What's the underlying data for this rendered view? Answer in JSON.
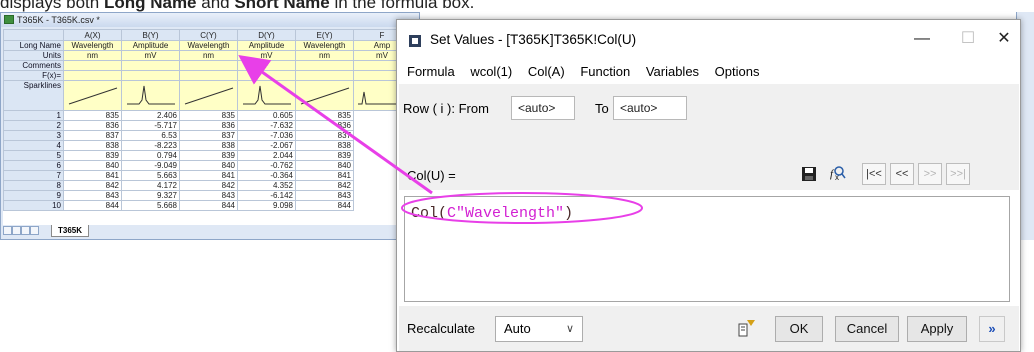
{
  "caption": {
    "prefix": "displays both ",
    "long_name": "Long Name",
    "middle": " and ",
    "short_name": "Short Name",
    "suffix": " in the formula box."
  },
  "worksheet": {
    "title": "T365K - T365K.csv *",
    "columns": [
      "A(X)",
      "B(Y)",
      "C(Y)",
      "D(Y)",
      "E(Y)",
      "F"
    ],
    "row_labels": {
      "long_name": "Long Name",
      "units": "Units",
      "comments": "Comments",
      "fx": "F(x)=",
      "sparklines": "Sparklines"
    },
    "long_names": [
      "Wavelength",
      "Amplitude",
      "Wavelength",
      "Amplitude",
      "Wavelength",
      "Amp"
    ],
    "units": [
      "nm",
      "mV",
      "nm",
      "mV",
      "nm",
      "mV"
    ],
    "rows": [
      [
        "1",
        "835",
        "2.406",
        "835",
        "0.605",
        "835"
      ],
      [
        "2",
        "836",
        "-5.717",
        "836",
        "-7.632",
        "836"
      ],
      [
        "3",
        "837",
        "6.53",
        "837",
        "-7.036",
        "837"
      ],
      [
        "4",
        "838",
        "-8.223",
        "838",
        "-2.067",
        "838"
      ],
      [
        "5",
        "839",
        "0.794",
        "839",
        "2.044",
        "839"
      ],
      [
        "6",
        "840",
        "-9.049",
        "840",
        "-0.762",
        "840"
      ],
      [
        "7",
        "841",
        "5.663",
        "841",
        "-0.364",
        "841"
      ],
      [
        "8",
        "842",
        "4.172",
        "842",
        "4.352",
        "842"
      ],
      [
        "9",
        "843",
        "9.327",
        "843",
        "-6.142",
        "843"
      ],
      [
        "10",
        "844",
        "5.668",
        "844",
        "9.098",
        "844"
      ]
    ],
    "sheet_tab": "T365K"
  },
  "dialog": {
    "title": "Set Values - [T365K]T365K!Col(U)",
    "menu": [
      "Formula",
      "wcol(1)",
      "Col(A)",
      "Function",
      "Variables",
      "Options"
    ],
    "row_label": "Row ( i ): From",
    "from_value": "<auto>",
    "to_label": "To",
    "to_value": "<auto>",
    "col_label": "Col(U) =",
    "nav_buttons": [
      "|<<",
      "<<",
      ">>",
      ">>|"
    ],
    "formula_fn": "Col(",
    "formula_arg": "C\"Wavelength\"",
    "formula_close": ")",
    "recalculate_label": "Recalculate",
    "recalculate_value": "Auto",
    "ok": "OK",
    "cancel": "Cancel",
    "apply": "Apply"
  },
  "colors": {
    "annotation": "#e83fe8",
    "meta_bg": "#ffffc6",
    "header_bg": "#dbe6f4"
  }
}
